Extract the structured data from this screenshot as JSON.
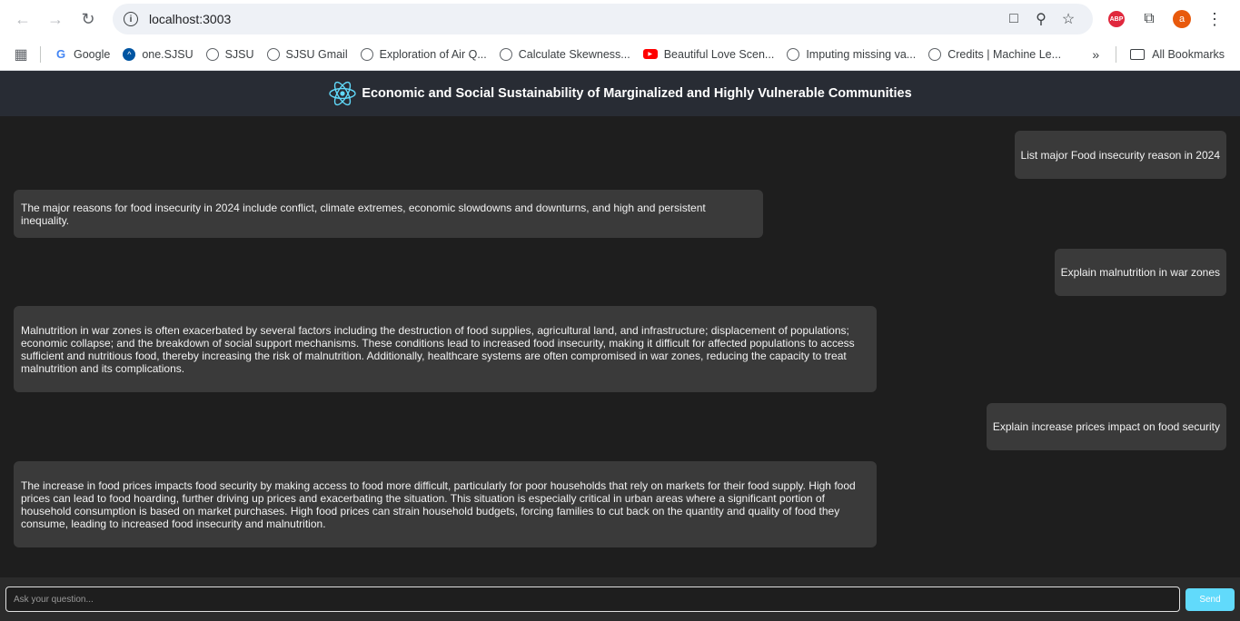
{
  "browser": {
    "url": "localhost:3003",
    "bookmarks": [
      {
        "label": "Google",
        "icon": "google-icon"
      },
      {
        "label": "one.SJSU",
        "icon": "sjsu-icon"
      },
      {
        "label": "SJSU",
        "icon": "globe-icon"
      },
      {
        "label": "SJSU Gmail",
        "icon": "globe-icon"
      },
      {
        "label": "Exploration of Air Q...",
        "icon": "globe-icon"
      },
      {
        "label": "Calculate Skewness...",
        "icon": "globe-icon"
      },
      {
        "label": "Beautiful Love Scen...",
        "icon": "youtube-icon"
      },
      {
        "label": "Imputing missing va...",
        "icon": "globe-icon"
      },
      {
        "label": "Credits | Machine Le...",
        "icon": "globe-icon"
      }
    ],
    "more_label": "»",
    "all_bookmarks": "All Bookmarks",
    "avatar_letter": "a",
    "abp_label": "ABP"
  },
  "app": {
    "title": "Economic and Social Sustainability of Marginalized and Highly Vulnerable Communities",
    "accent": "#61dafb"
  },
  "messages": [
    {
      "role": "user",
      "text": "List major Food insecurity reason in 2024"
    },
    {
      "role": "bot",
      "text": "The major reasons for food insecurity in 2024 include conflict, climate extremes, economic slowdowns and downturns, and high and persistent inequality."
    },
    {
      "role": "user",
      "text": "Explain malnutrition in war zones"
    },
    {
      "role": "bot",
      "text": "Malnutrition in war zones is often exacerbated by several factors including the destruction of food supplies, agricultural land, and infrastructure; displacement of populations; economic collapse; and the breakdown of social support mechanisms. These conditions lead to increased food insecurity, making it difficult for affected populations to access sufficient and nutritious food, thereby increasing the risk of malnutrition. Additionally, healthcare systems are often compromised in war zones, reducing the capacity to treat malnutrition and its complications."
    },
    {
      "role": "user",
      "text": "Explain increase prices impact on food security"
    },
    {
      "role": "bot",
      "text": "The increase in food prices impacts food security by making access to food more difficult, particularly for poor households that rely on markets for their food supply. High food prices can lead to food hoarding, further driving up prices and exacerbating the situation. This situation is especially critical in urban areas where a significant portion of household consumption is based on market purchases. High food prices can strain household budgets, forcing families to cut back on the quantity and quality of food they consume, leading to increased food insecurity and malnutrition."
    }
  ],
  "input": {
    "placeholder": "Ask your question...",
    "send_label": "Send"
  }
}
